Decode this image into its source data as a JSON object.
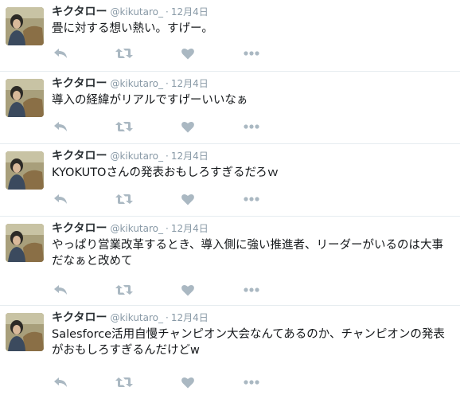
{
  "tweets": [
    {
      "name": "キクタロー",
      "handle": "@kikutaro_",
      "separator": "·",
      "time": "12月4日",
      "text": "畳に対する想い熱い。すげー。"
    },
    {
      "name": "キクタロー",
      "handle": "@kikutaro_",
      "separator": "·",
      "time": "12月4日",
      "text": "導入の経緯がリアルですげーいいなぁ"
    },
    {
      "name": "キクタロー",
      "handle": "@kikutaro_",
      "separator": "·",
      "time": "12月4日",
      "text": "KYOKUTOさんの発表おもしろすぎるだろｗ"
    },
    {
      "name": "キクタロー",
      "handle": "@kikutaro_",
      "separator": "·",
      "time": "12月4日",
      "text": "やっぱり営業改革するとき、導入側に強い推進者、リーダーがいるのは大事だなぁと改めて"
    },
    {
      "name": "キクタロー",
      "handle": "@kikutaro_",
      "separator": "·",
      "time": "12月4日",
      "text": "Salesforce活用自慢チャンピオン大会なんてあるのか、チャンピオンの発表がおもしろすぎるんだけどw"
    }
  ],
  "icons": {
    "reply": "reply-icon",
    "retweet": "retweet-icon",
    "like": "heart-icon",
    "more": "more-icon"
  },
  "colors": {
    "name": "#292f33",
    "meta": "#8899a6",
    "icon": "#aab8c2",
    "divider": "#e6ecf0"
  }
}
